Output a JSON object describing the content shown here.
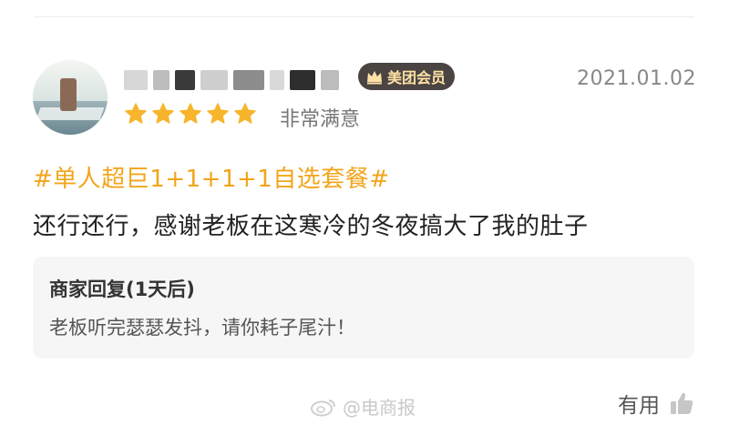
{
  "review": {
    "member_badge": "美团会员",
    "date": "2021.01.02",
    "rating": 5,
    "rating_max": 5,
    "rating_text": "非常满意",
    "topic": "#单人超巨1+1+1+1自选套餐#",
    "comment": "还行还行，感谢老板在这寒冷的冬夜搞大了我的肚子"
  },
  "merchant_reply": {
    "title": "商家回复(1天后)",
    "text": "老板听完瑟瑟发抖，请你耗子尾汁！"
  },
  "footer": {
    "watermark": "@电商报",
    "helpful_label": "有用"
  },
  "colors": {
    "star": "#f7b52c",
    "topic": "#f2a51a",
    "badge_bg": "#4a4443",
    "badge_text": "#ffe2a6",
    "reply_bg": "#f6f6f6"
  },
  "icons": {
    "badge": "crown-icon",
    "rating": "star-icon",
    "watermark": "weibo-icon",
    "helpful": "thumbs-up-icon"
  }
}
